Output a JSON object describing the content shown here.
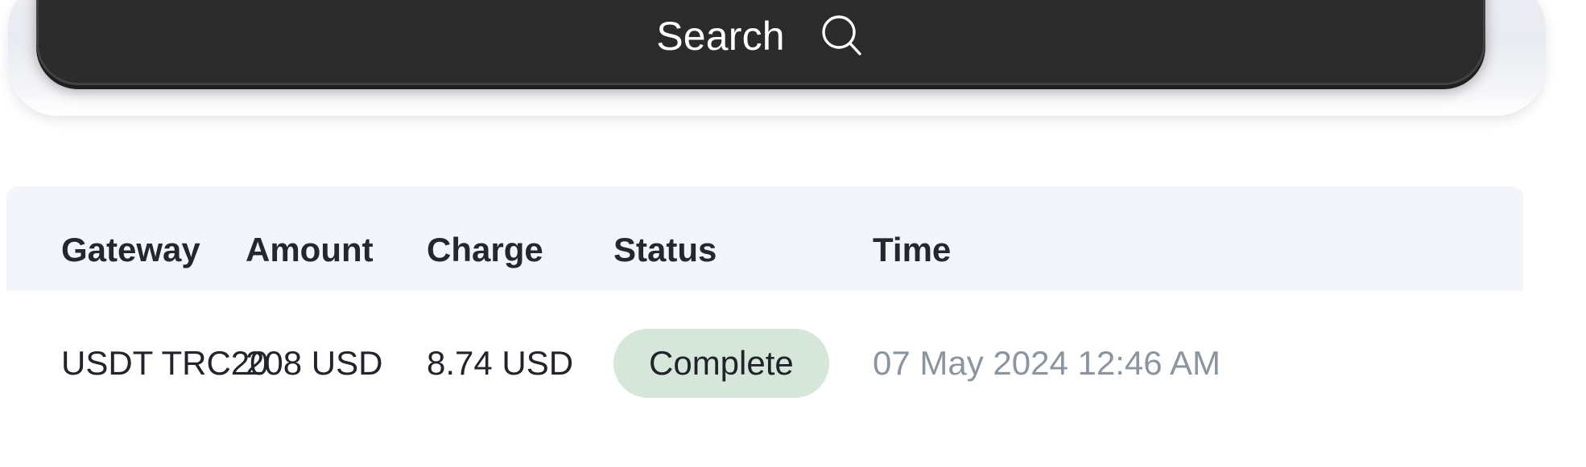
{
  "search": {
    "label": "Search",
    "icon": "search-icon"
  },
  "table": {
    "columns": [
      {
        "key": "gateway",
        "label": "Gateway"
      },
      {
        "key": "amount",
        "label": "Amount"
      },
      {
        "key": "charge",
        "label": "Charge"
      },
      {
        "key": "status",
        "label": "Status"
      },
      {
        "key": "time",
        "label": "Time"
      }
    ],
    "rows": [
      {
        "gateway": "USDT TRC20",
        "amount": "208 USD",
        "charge": "8.74 USD",
        "status": "Complete",
        "time": "07 May 2024 12:46 AM"
      }
    ]
  },
  "colors": {
    "search_background": "#2b2b2b",
    "search_text": "#ffffff",
    "header_background": "#f4f5fa",
    "header_text": "#242730",
    "row_text": "#21242b",
    "muted_text": "#8b959f",
    "status_complete_background": "#d7e6da",
    "status_complete_text": "#20242a"
  }
}
